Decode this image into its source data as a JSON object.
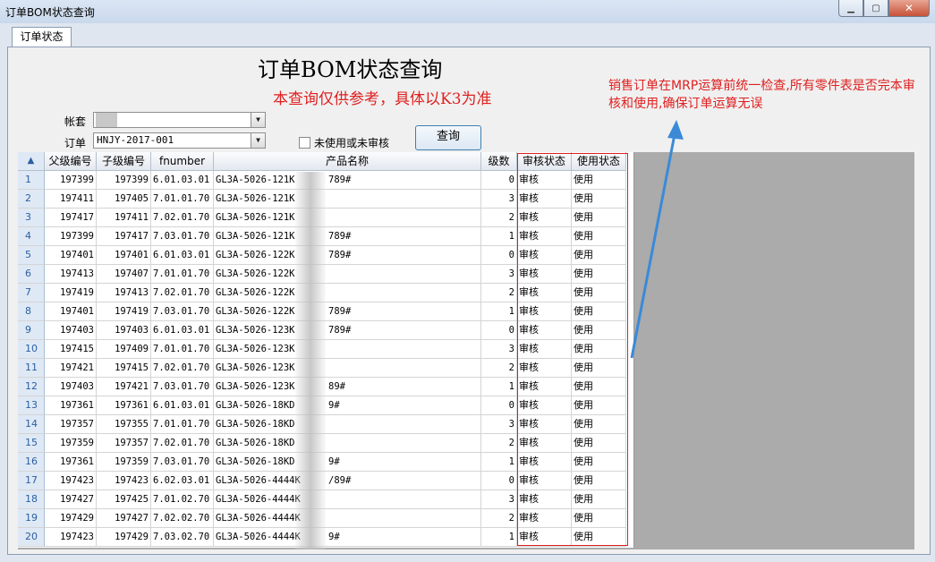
{
  "window": {
    "title": "订单BOM状态查询",
    "min": "▁",
    "max": "▢",
    "close": "✕"
  },
  "tab": "订单状态",
  "header": {
    "title": "订单BOM状态查询",
    "subtitle": "本查询仅供参考，具体以K3为准"
  },
  "note": "销售订单在MRP运算前统一检查,所有零件表是否完本审核和使用,确保订单运算无误",
  "form": {
    "account_label": "帐套",
    "account_value": "",
    "order_label": "订单",
    "order_value": "HNJY-2017-001",
    "checkbox_label": "未使用或未审核",
    "query_button": "查询"
  },
  "table": {
    "corner": "▲",
    "columns": [
      "父级编号",
      "子级编号",
      "fnumber",
      "产品名称",
      "级数",
      "审核状态",
      "使用状态"
    ],
    "rows": [
      [
        "1",
        "197399",
        "197399",
        "6.01.03.01",
        "GL3A-5026-121K",
        "789#",
        "0",
        "审核",
        "使用"
      ],
      [
        "2",
        "197411",
        "197405",
        "7.01.01.70",
        "GL3A-5026-121K",
        "",
        "3",
        "审核",
        "使用"
      ],
      [
        "3",
        "197417",
        "197411",
        "7.02.01.70",
        "GL3A-5026-121K",
        "",
        "2",
        "审核",
        "使用"
      ],
      [
        "4",
        "197399",
        "197417",
        "7.03.01.70",
        "GL3A-5026-121K",
        "789#",
        "1",
        "审核",
        "使用"
      ],
      [
        "5",
        "197401",
        "197401",
        "6.01.03.01",
        "GL3A-5026-122K",
        "789#",
        "0",
        "审核",
        "使用"
      ],
      [
        "6",
        "197413",
        "197407",
        "7.01.01.70",
        "GL3A-5026-122K",
        "",
        "3",
        "审核",
        "使用"
      ],
      [
        "7",
        "197419",
        "197413",
        "7.02.01.70",
        "GL3A-5026-122K",
        "",
        "2",
        "审核",
        "使用"
      ],
      [
        "8",
        "197401",
        "197419",
        "7.03.01.70",
        "GL3A-5026-122K",
        "789#",
        "1",
        "审核",
        "使用"
      ],
      [
        "9",
        "197403",
        "197403",
        "6.01.03.01",
        "GL3A-5026-123K",
        "789#",
        "0",
        "审核",
        "使用"
      ],
      [
        "10",
        "197415",
        "197409",
        "7.01.01.70",
        "GL3A-5026-123K",
        "",
        "3",
        "审核",
        "使用"
      ],
      [
        "11",
        "197421",
        "197415",
        "7.02.01.70",
        "GL3A-5026-123K",
        "",
        "2",
        "审核",
        "使用"
      ],
      [
        "12",
        "197403",
        "197421",
        "7.03.01.70",
        "GL3A-5026-123K",
        "89#",
        "1",
        "审核",
        "使用"
      ],
      [
        "13",
        "197361",
        "197361",
        "6.01.03.01",
        "GL3A-5026-18KD",
        "9#",
        "0",
        "审核",
        "使用"
      ],
      [
        "14",
        "197357",
        "197355",
        "7.01.01.70",
        "GL3A-5026-18KD",
        "",
        "3",
        "审核",
        "使用"
      ],
      [
        "15",
        "197359",
        "197357",
        "7.02.01.70",
        "GL3A-5026-18KD",
        "",
        "2",
        "审核",
        "使用"
      ],
      [
        "16",
        "197361",
        "197359",
        "7.03.01.70",
        "GL3A-5026-18KD",
        "9#",
        "1",
        "审核",
        "使用"
      ],
      [
        "17",
        "197423",
        "197423",
        "6.02.03.01",
        "GL3A-5026-4444K",
        "/89#",
        "0",
        "审核",
        "使用"
      ],
      [
        "18",
        "197427",
        "197425",
        "7.01.02.70",
        "GL3A-5026-4444K",
        "",
        "3",
        "审核",
        "使用"
      ],
      [
        "19",
        "197429",
        "197427",
        "7.02.02.70",
        "GL3A-5026-4444K",
        "",
        "2",
        "审核",
        "使用"
      ],
      [
        "20",
        "197423",
        "197429",
        "7.03.02.70",
        "GL3A-5026-4444K",
        "9#",
        "1",
        "审核",
        "使用"
      ]
    ]
  },
  "colors": {
    "annotation": "#e02020",
    "arrow": "#3a8ad8"
  }
}
